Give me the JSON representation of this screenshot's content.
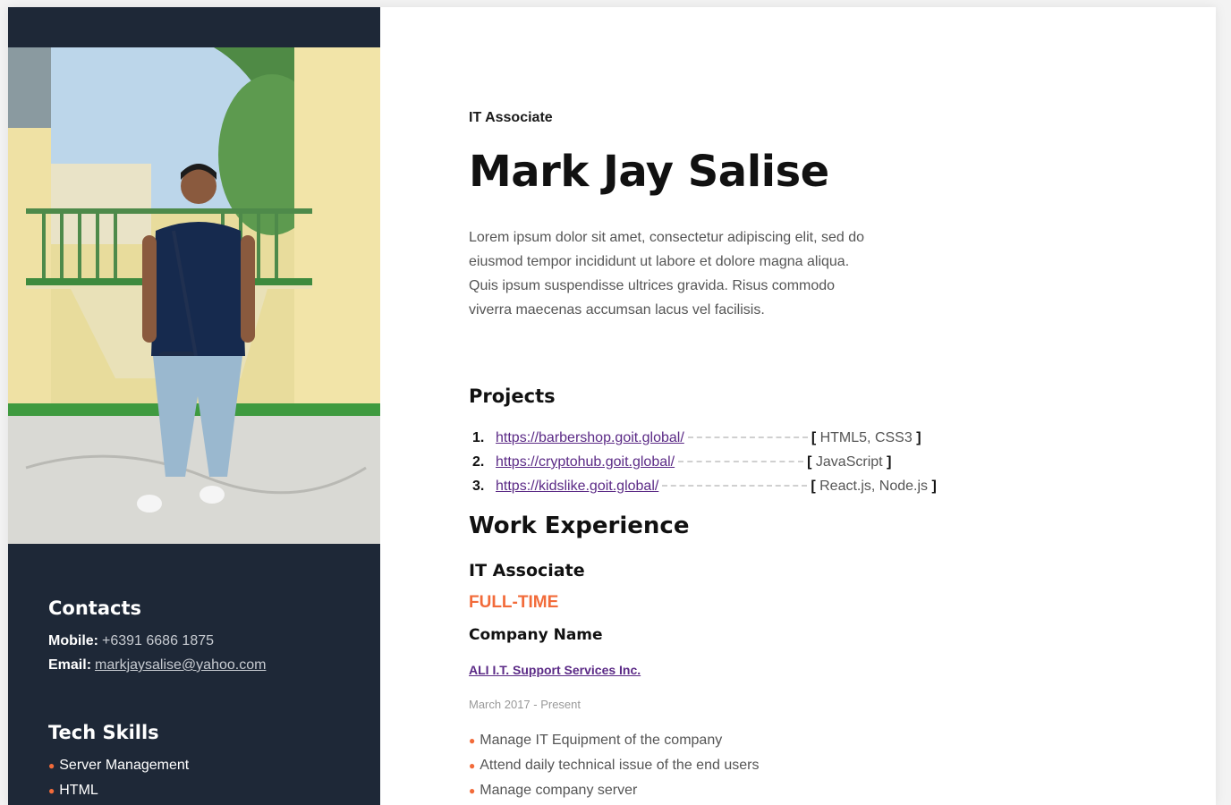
{
  "header": {
    "role": "IT Associate",
    "name": "Mark Jay Salise",
    "bio": "Lorem ipsum dolor sit amet, consectetur adipiscing elit, sed do eiusmod tempor incididunt ut labore et dolore magna aliqua. Quis ipsum suspendisse ultrices gravida. Risus commodo viverra maecenas accumsan lacus vel facilisis."
  },
  "sidebar": {
    "contacts_title": "Contacts",
    "mobile_label": "Mobile:",
    "mobile_value": "+6391 6686 1875",
    "email_label": "Email:",
    "email_value": "markjaysalise@yahoo.com",
    "skills_title": "Tech Skills",
    "skills": [
      "Server Management",
      "HTML"
    ]
  },
  "projects": {
    "title": "Projects",
    "items": [
      {
        "num": "1.",
        "url": "https://barbershop.goit.global/",
        "tech": "HTML5, CSS3"
      },
      {
        "num": "2.",
        "url": "https://cryptohub.goit.global/",
        "tech": "JavaScript"
      },
      {
        "num": "3.",
        "url": "https://kidslike.goit.global/",
        "tech": "React.js, Node.js"
      }
    ]
  },
  "work": {
    "title": "Work Experience",
    "job_title": "IT Associate",
    "job_type": "FULL-TIME",
    "company_label": "Company Name",
    "company_name": "ALI I.T. Support Services Inc.",
    "dates": "March 2017 - Present",
    "duties": [
      "Manage IT Equipment of the company",
      "Attend daily technical issue of the end users",
      "Manage company server"
    ]
  },
  "colors": {
    "sidebar_bg": "#1e2837",
    "accent": "#f26b3a",
    "link": "#5b2a86"
  }
}
